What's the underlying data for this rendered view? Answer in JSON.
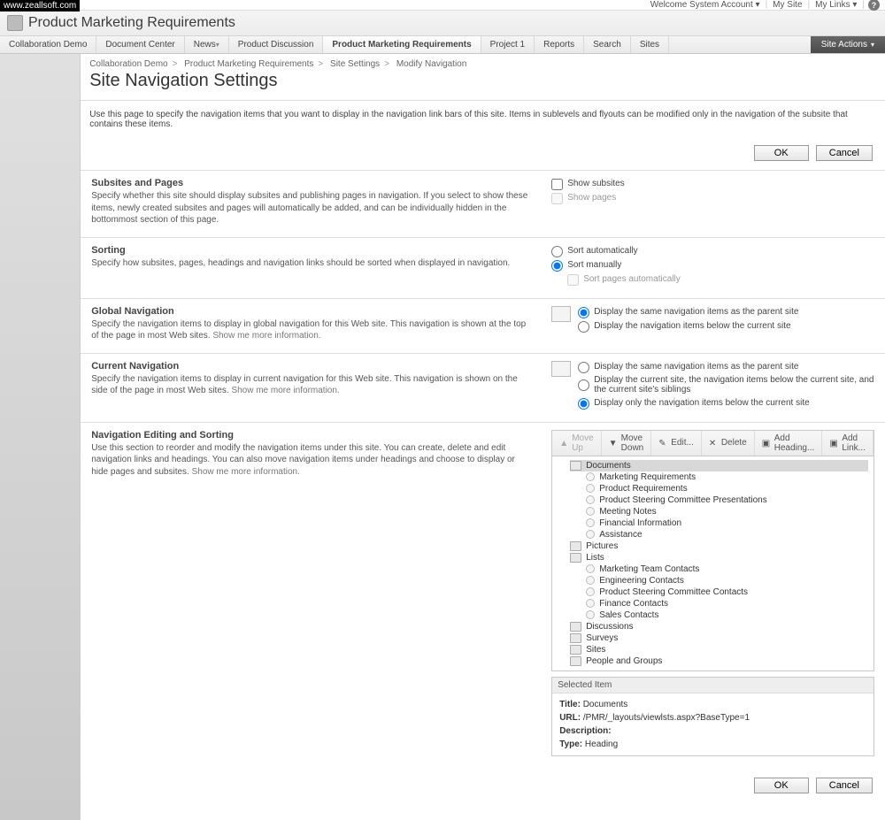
{
  "watermark": "www.zeallsoft.com",
  "topbar": {
    "welcome": "Welcome System Account",
    "mysite": "My Site",
    "mylinks": "My Links"
  },
  "site_title": "Product Marketing Requirements",
  "tabs": [
    "Collaboration Demo",
    "Document Center",
    "News",
    "Product Discussion",
    "Product Marketing Requirements",
    "Project 1",
    "Reports",
    "Search",
    "Sites"
  ],
  "site_actions": "Site Actions",
  "breadcrumb": [
    "Collaboration Demo",
    "Product Marketing Requirements",
    "Site Settings",
    "Modify Navigation"
  ],
  "page_title": "Site Navigation Settings",
  "intro": "Use this page to specify the navigation items that you want to display in the navigation link bars of this site. Items in sublevels and flyouts can be modified only in the navigation of the subsite that contains these items.",
  "buttons": {
    "ok": "OK",
    "cancel": "Cancel"
  },
  "sections": {
    "subsites": {
      "title": "Subsites and Pages",
      "desc": "Specify whether this site should display subsites and publishing pages in navigation. If you select to show these items, newly created subsites and pages will automatically be added, and can be individually hidden in the bottommost section of this page.",
      "show_subsites": "Show subsites",
      "show_pages": "Show pages"
    },
    "sorting": {
      "title": "Sorting",
      "desc": "Specify how subsites, pages, headings and navigation links should be sorted when displayed in navigation.",
      "auto": "Sort automatically",
      "manual": "Sort manually",
      "pages_auto": "Sort pages automatically"
    },
    "global": {
      "title": "Global Navigation",
      "desc": "Specify the navigation items to display in global navigation for this Web site. This navigation is shown at the top of the page in most Web sites. ",
      "more": "Show me more information.",
      "same": "Display the same navigation items as the parent site",
      "below": "Display the navigation items below the current site"
    },
    "current": {
      "title": "Current Navigation",
      "desc": "Specify the navigation items to display in current navigation for this Web site. This navigation is shown on the side of the page in most Web sites. ",
      "more": "Show me more information.",
      "same": "Display the same navigation items as the parent site",
      "siblings": "Display the current site, the navigation items below the current site, and the current site's siblings",
      "only": "Display only the navigation items below the current site"
    },
    "editing": {
      "title": "Navigation Editing and Sorting",
      "desc": "Use this section to reorder and modify the navigation items under this site. You can create, delete and edit navigation links and headings. You can also move navigation items under headings and choose to display or hide pages and subsites. ",
      "more": "Show me more information."
    }
  },
  "toolbar": {
    "moveup": "Move\nUp",
    "movedown": "Move\nDown",
    "edit": "Edit...",
    "delete": "Delete",
    "addheading": "Add\nHeading...",
    "addlink": "Add\nLink..."
  },
  "tree": {
    "documents": "Documents",
    "doc_children": [
      "Marketing Requirements",
      "Product Requirements",
      "Product Steering Committee Presentations",
      "Meeting Notes",
      "Financial Information",
      "Assistance"
    ],
    "pictures": "Pictures",
    "lists": "Lists",
    "list_children": [
      "Marketing Team Contacts",
      "Engineering Contacts",
      "Product Steering Committee Contacts",
      "Finance Contacts",
      "Sales Contacts"
    ],
    "discussions": "Discussions",
    "surveys": "Surveys",
    "sites": "Sites",
    "people": "People and Groups"
  },
  "selected": {
    "header": "Selected Item",
    "title_lbl": "Title:",
    "title": "Documents",
    "url_lbl": "URL:",
    "url": "/PMR/_layouts/viewlsts.aspx?BaseType=1",
    "desc_lbl": "Description:",
    "type_lbl": "Type:",
    "type": "Heading"
  }
}
